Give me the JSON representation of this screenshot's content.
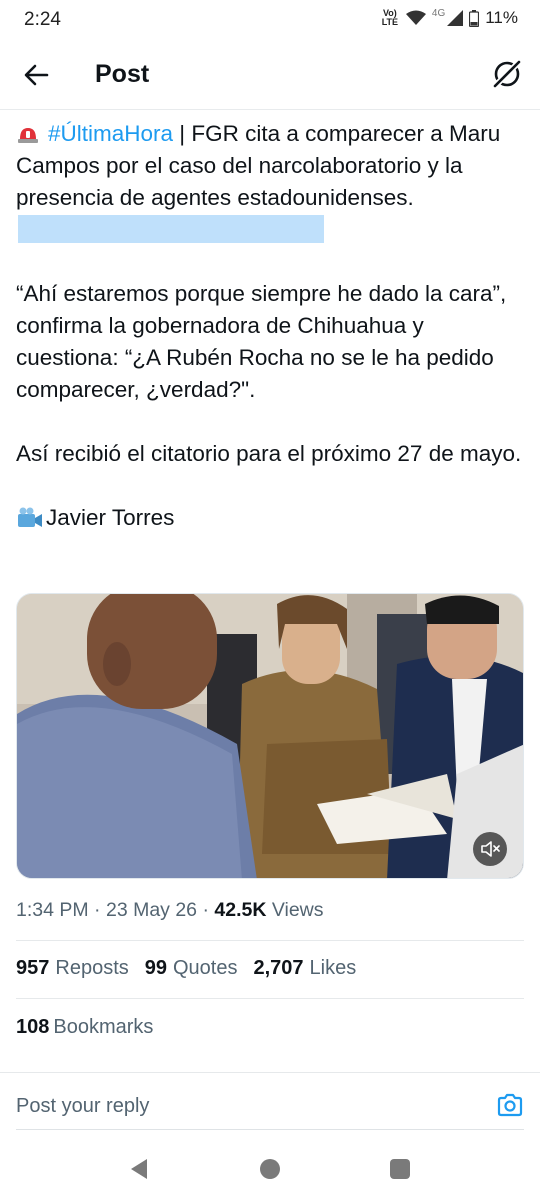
{
  "status_bar": {
    "time": "2:24",
    "volte_label_top": "Vo)",
    "volte_label_bottom": "LTE",
    "network": "4G",
    "battery": "11%"
  },
  "header": {
    "title": "Post"
  },
  "tweet": {
    "hashtag": "#ÚltimaHora",
    "line1_rest": " | FGR cita a comparecer a Maru Campos por el caso del narcolaboratorio y la presencia de agentes estadounidenses.",
    "paragraph2": "“Ahí estaremos porque siempre he dado la cara”, confirma la gobernadora de Chihuahua y cuestiona: “¿A Rubén Rocha no se le ha pedido comparecer, ¿verdad?\".",
    "paragraph3": "Así recibió el citatorio para el próximo 27 de mayo.",
    "credit": "Javier Torres"
  },
  "meta": {
    "time": "1:34 PM",
    "separator": " · ",
    "date": "23 May 26",
    "views_count": "42.5K",
    "views_label": " Views"
  },
  "stats": {
    "reposts_count": "957",
    "reposts_label": "Reposts",
    "quotes_count": "99",
    "quotes_label": "Quotes",
    "likes_count": "2,707",
    "likes_label": "Likes",
    "bookmarks_count": "108",
    "bookmarks_label": "Bookmarks"
  },
  "reply": {
    "placeholder": "Post your reply"
  },
  "colors": {
    "accent": "#1d9bf0",
    "text": "#0f1419",
    "muted": "#536471",
    "redaction": "#bfe0fb"
  }
}
